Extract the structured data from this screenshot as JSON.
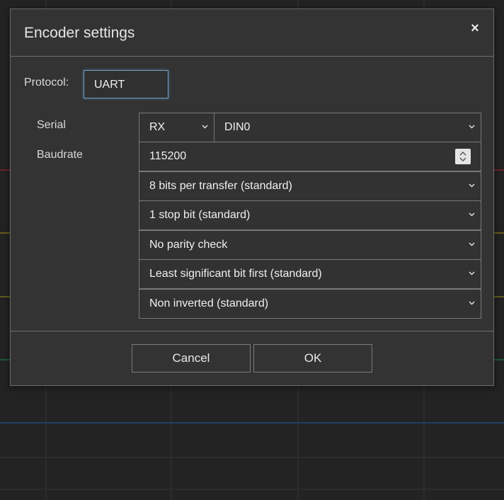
{
  "dialog": {
    "title": "Encoder settings",
    "close_icon": "×",
    "protocol_label": "Protocol:",
    "protocol_value": "UART"
  },
  "form": {
    "serial_label": "Serial",
    "baudrate_label": "Baudrate",
    "serial_direction": "RX",
    "serial_channel": "DIN0",
    "baudrate_value": "115200",
    "data_bits": "8 bits per transfer (standard)",
    "stop_bits": "1 stop bit (standard)",
    "parity": "No parity check",
    "bit_order": "Least significant bit first (standard)",
    "polarity": "Non inverted (standard)"
  },
  "buttons": {
    "cancel": "Cancel",
    "ok": "OK"
  },
  "colors": {
    "dialog_bg": "#333333",
    "focus_border": "#6d9fc7",
    "backdrop": "#232323"
  }
}
